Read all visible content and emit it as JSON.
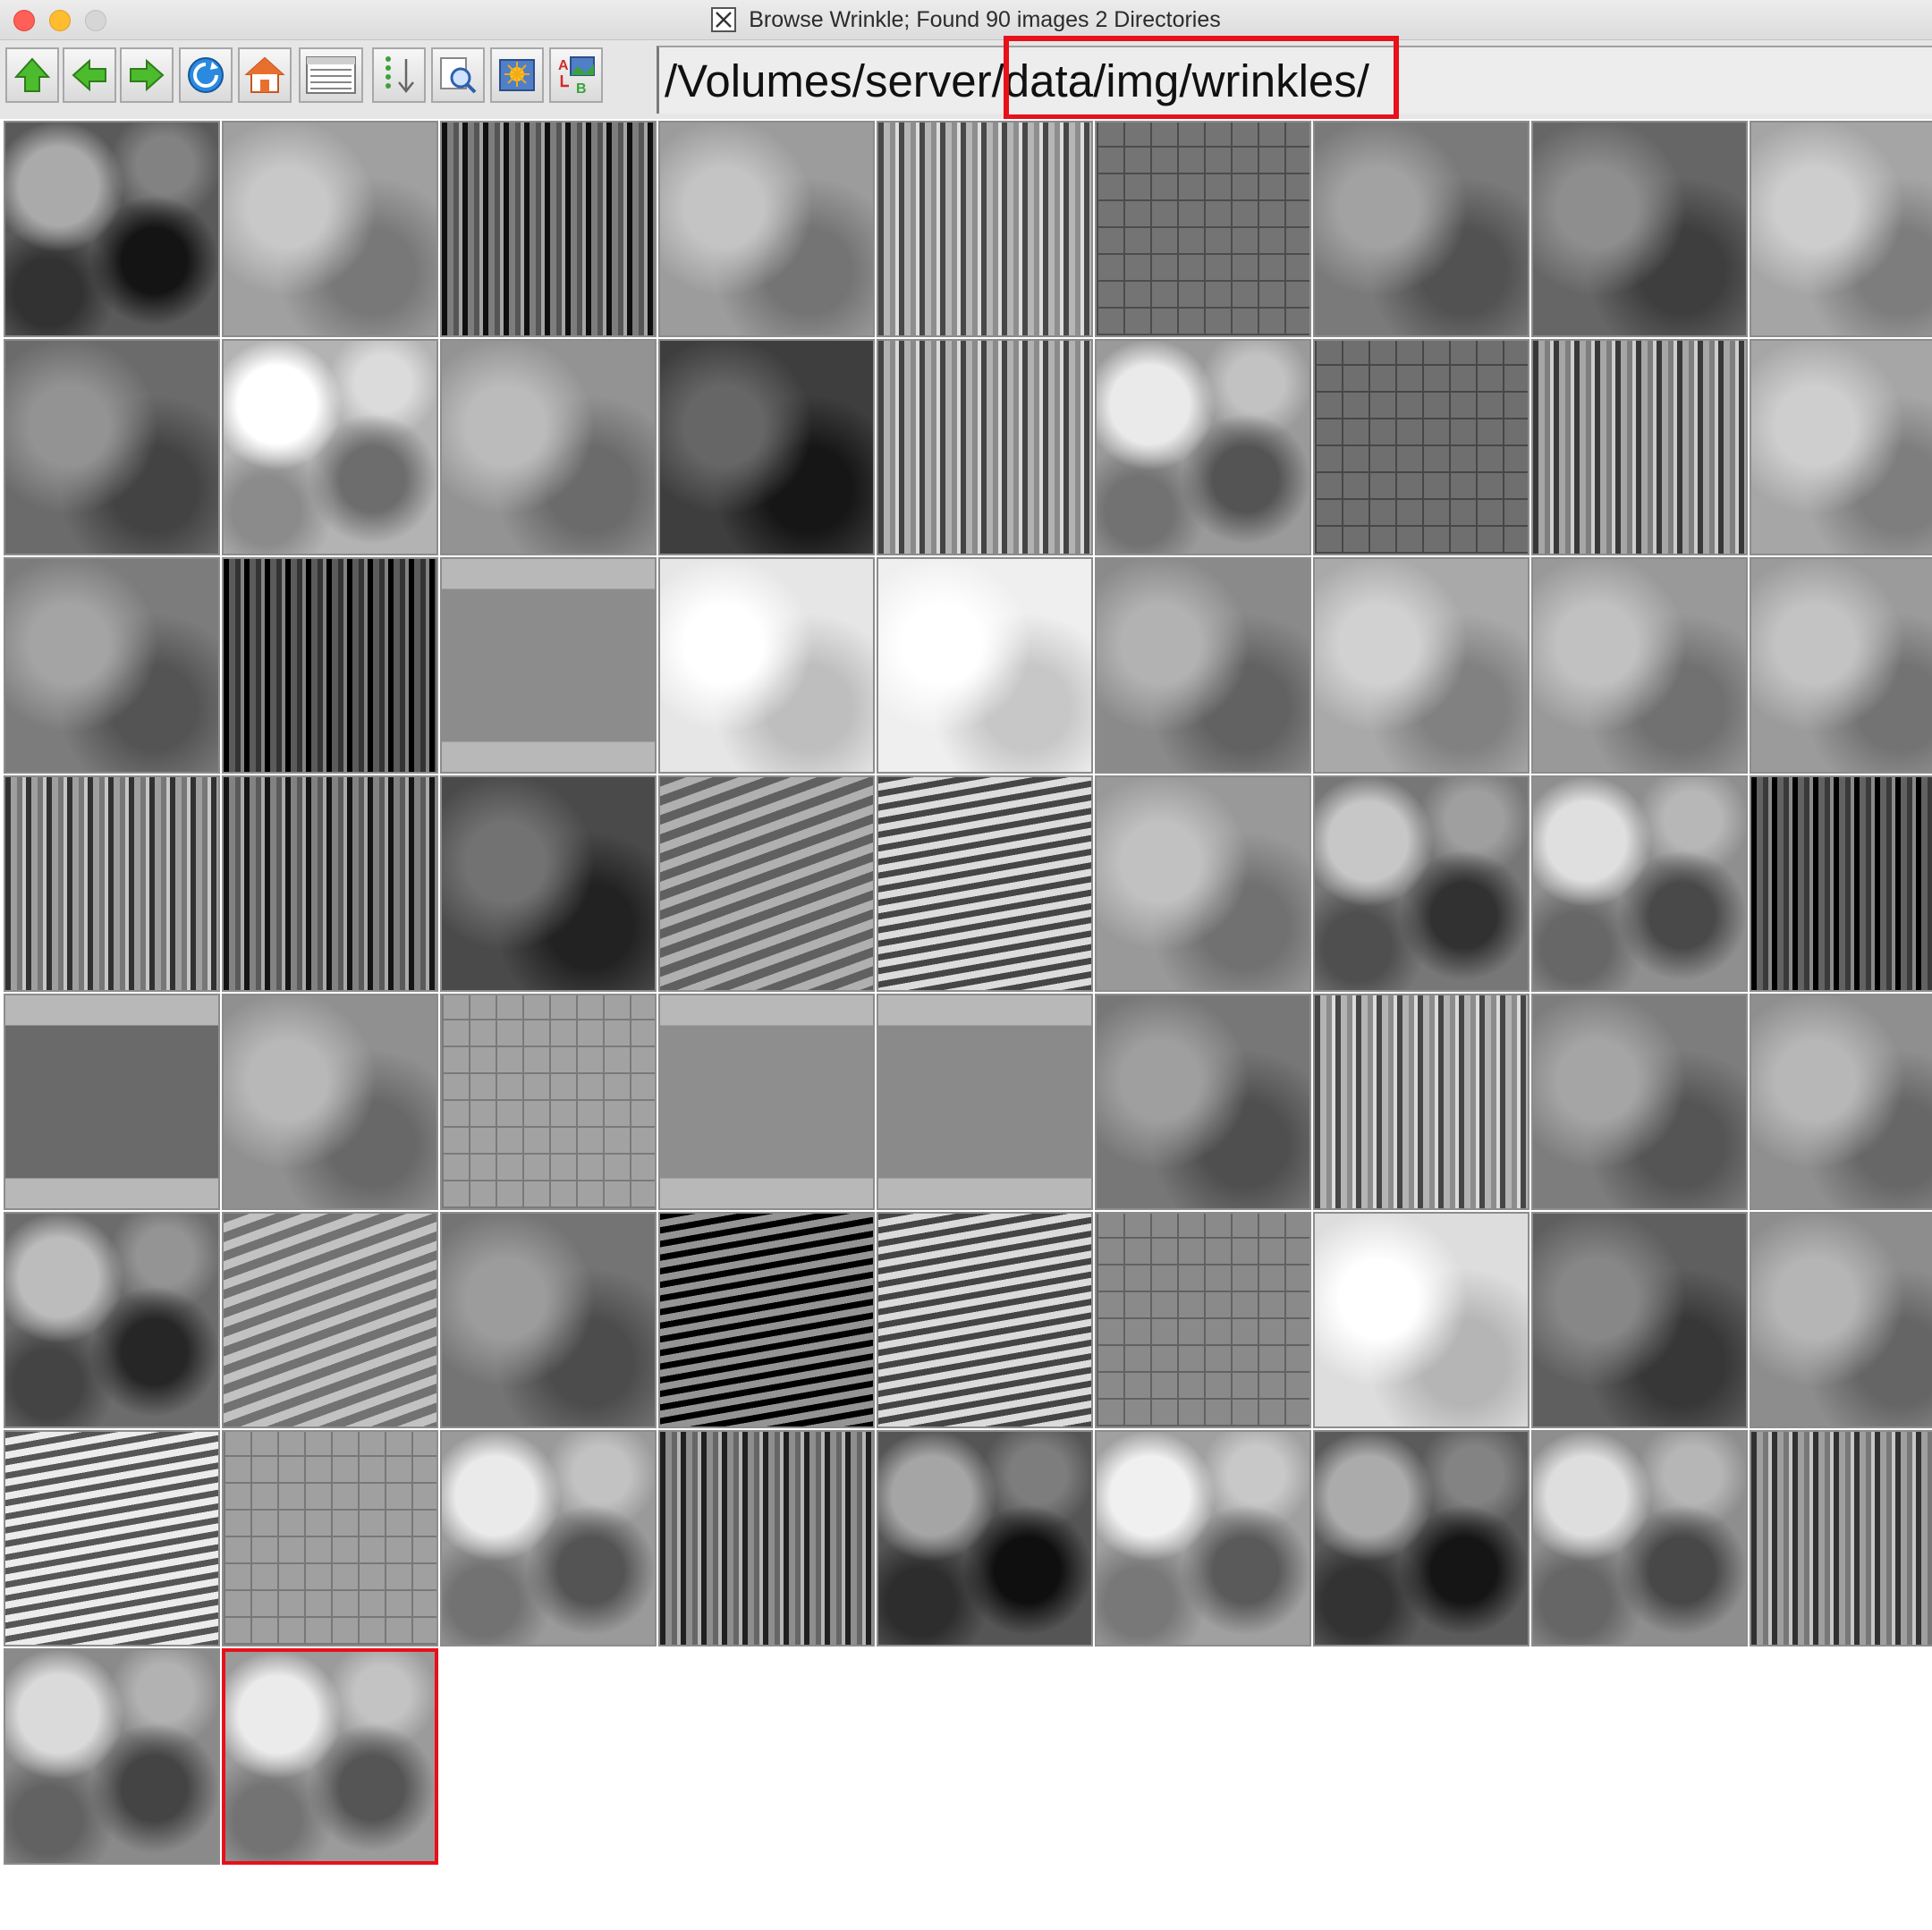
{
  "window": {
    "title": "Browse Wrinkle; Found 90 images 2 Directories",
    "app_icon": "x11-icon",
    "controls": [
      "close",
      "minimize",
      "zoom"
    ]
  },
  "toolbar": {
    "buttons": [
      {
        "name": "up-directory-button",
        "icon": "up-arrow-icon",
        "color": "#3fae2a"
      },
      {
        "name": "back-button",
        "icon": "left-arrow-icon",
        "color": "#3fae2a"
      },
      {
        "name": "forward-button",
        "icon": "right-arrow-icon",
        "color": "#3fae2a"
      },
      {
        "name": "refresh-button",
        "icon": "refresh-icon",
        "color": "#1c7fd6"
      },
      {
        "name": "home-button",
        "icon": "home-icon",
        "color": "#e0662a"
      },
      {
        "name": "list-view-button",
        "icon": "list-view-icon",
        "color": "#555555"
      },
      {
        "name": "sort-button",
        "icon": "sort-down-icon",
        "color": "#666666"
      },
      {
        "name": "search-button",
        "icon": "magnifier-icon",
        "color": "#2d5fb0"
      },
      {
        "name": "new-image-button",
        "icon": "image-sparkle-icon",
        "color": "#e8a317"
      },
      {
        "name": "rename-button",
        "icon": "image-rename-icon",
        "color": "#d42a2a"
      }
    ],
    "path": "/Volumes/server/data/img/wrinkles/",
    "path_highlight_color": "#e8101a"
  },
  "grid": {
    "image_count": 65,
    "columns": 9,
    "selected_index": 64,
    "selection_color": "#e8101a",
    "thumbnails": [
      {
        "t": "water-caustic",
        "c": "#5a5a5a"
      },
      {
        "t": "soft-bumps",
        "c": "#a0a0a0"
      },
      {
        "t": "vertical-gradient-streaks",
        "c": "#555555"
      },
      {
        "t": "fine-noise",
        "c": "#9c9c9c"
      },
      {
        "t": "vertical-folds",
        "c": "#8e8e8e"
      },
      {
        "t": "woven-mottled",
        "c": "#747474"
      },
      {
        "t": "bark-ridges",
        "c": "#7a7a7a"
      },
      {
        "t": "flat-dark",
        "c": "#666666"
      },
      {
        "t": "speckle-light",
        "c": "#a5a5a5"
      },
      {
        "t": "granite",
        "c": "#6b6b6b"
      },
      {
        "t": "crumpled-paper",
        "c": "#b3b3b3"
      },
      {
        "t": "fibrous",
        "c": "#939393"
      },
      {
        "t": "dark-scratches",
        "c": "#3e3e3e"
      },
      {
        "t": "streaky-wave",
        "c": "#8a8a8a"
      },
      {
        "t": "cloth-folds",
        "c": "#9a9a9a"
      },
      {
        "t": "denim",
        "c": "#6f6f6f"
      },
      {
        "t": "vertical-stripes",
        "c": "#7e7e7e"
      },
      {
        "t": "cracked-light",
        "c": "#a6a6a6"
      },
      {
        "t": "noise-mid",
        "c": "#7c7c7c"
      },
      {
        "t": "hair-dark",
        "c": "#333333"
      },
      {
        "t": "flat-banded",
        "c": "#8c8c8c"
      },
      {
        "t": "white-crinkle",
        "c": "#e6e6e6"
      },
      {
        "t": "white-lines",
        "c": "#efefef"
      },
      {
        "t": "bumpy-rough",
        "c": "#8a8a8a"
      },
      {
        "t": "smooth-light",
        "c": "#a9a9a9"
      },
      {
        "t": "facets",
        "c": "#999999"
      },
      {
        "t": "leather-grain",
        "c": "#9b9b9b"
      },
      {
        "t": "streaks-contrast",
        "c": "#777777"
      },
      {
        "t": "streaks-dark",
        "c": "#5a5a5a"
      },
      {
        "t": "blur-dark",
        "c": "#4a4a4a"
      },
      {
        "t": "diagonal-bands",
        "c": "#888888"
      },
      {
        "t": "wave-ripple",
        "c": "#8c8c8c"
      },
      {
        "t": "swirl-emboss",
        "c": "#999999"
      },
      {
        "t": "clouds",
        "c": "#777777"
      },
      {
        "t": "rock-smooth",
        "c": "#8f8f8f"
      },
      {
        "t": "dark-streaks",
        "c": "#3a3a3a"
      },
      {
        "t": "silk-folds",
        "c": "#6a6a6a"
      },
      {
        "t": "flat-grey",
        "c": "#909090"
      },
      {
        "t": "quilt",
        "c": "#a2a2a2"
      },
      {
        "t": "fine-grain",
        "c": "#8e8e8e"
      },
      {
        "t": "rough-noise",
        "c": "#8a8a8a"
      },
      {
        "t": "dark-noise",
        "c": "#777777"
      },
      {
        "t": "fine-vertical",
        "c": "#8c8c8c"
      },
      {
        "t": "wrinkled-skin",
        "c": "#7d7d7d"
      },
      {
        "t": "soft-grey",
        "c": "#8f8f8f"
      },
      {
        "t": "cloud-dark",
        "c": "#6c6c6c"
      },
      {
        "t": "stripes-diagonal",
        "c": "#9a9a9a"
      },
      {
        "t": "fabric-grey",
        "c": "#747474"
      },
      {
        "t": "zebra-waves",
        "c": "#444444"
      },
      {
        "t": "wood-grain-light",
        "c": "#8b8b8b"
      },
      {
        "t": "woven-cross",
        "c": "#8a8a8a"
      },
      {
        "t": "white-cracks",
        "c": "#dddddd"
      },
      {
        "t": "rust-dark",
        "c": "#5f5f5f"
      },
      {
        "t": "plain-grey",
        "c": "#8d8d8d"
      },
      {
        "t": "wood-rings",
        "c": "#9c9c9c"
      },
      {
        "t": "mesh-fine",
        "c": "#a0a0a0"
      },
      {
        "t": "crumple-emboss",
        "c": "#9a9a9a"
      },
      {
        "t": "liquid-vertical",
        "c": "#666666"
      },
      {
        "t": "liquid-dark",
        "c": "#555555"
      },
      {
        "t": "liquid-light",
        "c": "#a0a0a0"
      },
      {
        "t": "liquid-metal",
        "c": "#5b5b5b"
      },
      {
        "t": "liquid-chrome",
        "c": "#8e8e8e"
      },
      {
        "t": "bw-waves",
        "c": "#777777"
      },
      {
        "t": "blobs",
        "c": "#8a8a8a"
      },
      {
        "t": "marble-cloud",
        "c": "#9b9b9b"
      }
    ]
  }
}
